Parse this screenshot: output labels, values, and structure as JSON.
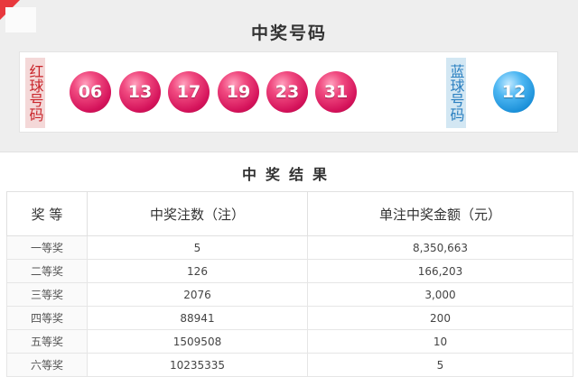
{
  "winning_numbers": {
    "title": "中奖号码",
    "red_label": "红球号码",
    "blue_label": "蓝球号码",
    "red_balls": [
      "06",
      "13",
      "17",
      "19",
      "23",
      "31"
    ],
    "blue_ball": "12",
    "colors": {
      "red_ball": "#e0186a",
      "blue_ball": "#1a8fd8",
      "accent": "#e8383d"
    }
  },
  "results": {
    "title": "中奖结果",
    "headers": [
      "奖 等",
      "中奖注数（注）",
      "单注中奖金额（元）"
    ],
    "rows": [
      {
        "grade": "一等奖",
        "count": "5",
        "amount": "8,350,663"
      },
      {
        "grade": "二等奖",
        "count": "126",
        "amount": "166,203"
      },
      {
        "grade": "三等奖",
        "count": "2076",
        "amount": "3,000"
      },
      {
        "grade": "四等奖",
        "count": "88941",
        "amount": "200"
      },
      {
        "grade": "五等奖",
        "count": "1509508",
        "amount": "10"
      },
      {
        "grade": "六等奖",
        "count": "10235335",
        "amount": "5"
      }
    ]
  }
}
